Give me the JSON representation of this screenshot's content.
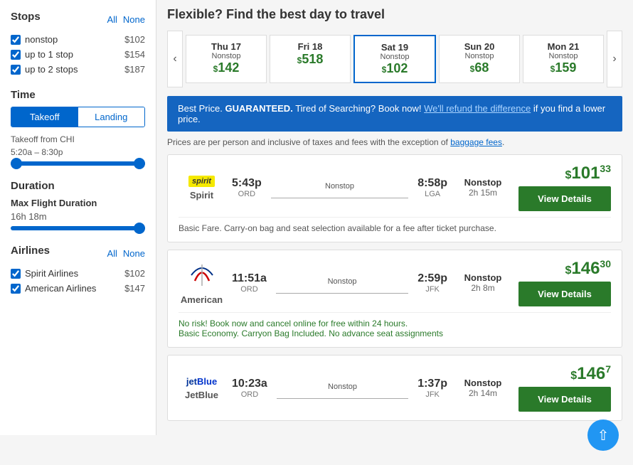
{
  "sidebar": {
    "stops_title": "Stops",
    "all_label": "All",
    "none_label": "None",
    "stop_options": [
      {
        "label": "nonstop",
        "price": "$102",
        "checked": true
      },
      {
        "label": "up to 1 stop",
        "price": "$154",
        "checked": true
      },
      {
        "label": "up to 2 stops",
        "price": "$187",
        "checked": true
      }
    ],
    "time_title": "Time",
    "takeoff_label": "Takeoff",
    "landing_label": "Landing",
    "takeoff_from": "Takeoff from CHI",
    "takeoff_range": "5:20a – 8:30p",
    "duration_title": "Duration",
    "max_flight_label": "Max Flight Duration",
    "max_flight_value": "16h 18m",
    "airlines_title": "Airlines",
    "airlines_all": "All",
    "airlines_none": "None",
    "airline_options": [
      {
        "label": "Spirit Airlines",
        "price": "$102",
        "checked": true
      },
      {
        "label": "American Airlines",
        "price": "$147",
        "checked": true
      }
    ]
  },
  "main": {
    "page_title": "Flexible? Find the best day to travel",
    "days": [
      {
        "name": "Thu 17",
        "stop_type": "Nonstop",
        "price": "$142"
      },
      {
        "name": "Fri 18",
        "stop_type": "",
        "price": "$518"
      },
      {
        "name": "Sat 19",
        "stop_type": "Nonstop",
        "price": "$102",
        "selected": true
      },
      {
        "name": "Sun 20",
        "stop_type": "Nonstop",
        "price": "$68"
      },
      {
        "name": "Mon 21",
        "stop_type": "Nonstop",
        "price": "$159"
      }
    ],
    "banner": {
      "text_start": "Best Price. ",
      "text_bold": "GUARANTEED.",
      "text_mid": " Tired of Searching? Book now! ",
      "text_link": "We'll refund the difference",
      "text_end": " if you find a lower price."
    },
    "info_text_start": "Prices are per person and inclusive of taxes and fees with the exception of ",
    "info_text_link": "baggage fees",
    "info_text_end": ".",
    "flights": [
      {
        "airline_code": "spirit",
        "airline_name": "Spirit",
        "depart_time": "5:43p",
        "depart_airport": "ORD",
        "arrive_time": "8:58p",
        "arrive_airport": "LGA",
        "stop_type": "Nonstop",
        "duration": "2h 15m",
        "price_dollars": "$101",
        "price_cents": "33",
        "note": "Basic Fare. Carry-on bag and seat selection available for a fee after ticket purchase.",
        "note_type": "normal"
      },
      {
        "airline_code": "american",
        "airline_name": "American",
        "depart_time": "11:51a",
        "depart_airport": "ORD",
        "arrive_time": "2:59p",
        "arrive_airport": "JFK",
        "stop_type": "Nonstop",
        "duration": "2h 8m",
        "price_dollars": "$146",
        "price_cents": "30",
        "note": "No risk! Book now and cancel online for free within 24 hours.\nBasic Economy. Carryon Bag Included. No advance seat assignments",
        "note_type": "green"
      },
      {
        "airline_code": "jetblue",
        "airline_name": "JetBlue",
        "depart_time": "10:23a",
        "depart_airport": "ORD",
        "arrive_time": "1:37p",
        "arrive_airport": "JFK",
        "stop_type": "Nonstop",
        "duration": "2h 14m",
        "price_dollars": "$146",
        "price_cents": "7",
        "note": "",
        "note_type": "normal"
      }
    ],
    "view_details_label": "View Details"
  }
}
